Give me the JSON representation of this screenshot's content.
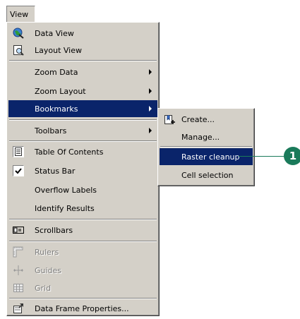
{
  "menubar": {
    "view_label": "View"
  },
  "view_menu": {
    "items": [
      {
        "label": "Data View",
        "icon": "globe-icon"
      },
      {
        "label": "Layout View",
        "icon": "page-magnifier-icon"
      },
      {
        "label": "Zoom Data"
      },
      {
        "label": "Zoom Layout"
      },
      {
        "label": "Bookmarks"
      },
      {
        "label": "Toolbars"
      },
      {
        "label": "Table Of Contents",
        "icon": "table-of-contents-icon"
      },
      {
        "label": "Status Bar",
        "icon": "checkmark-icon"
      },
      {
        "label": "Overflow Labels"
      },
      {
        "label": "Identify Results"
      },
      {
        "label": "Scrollbars",
        "icon": "scrollbar-icon"
      },
      {
        "label": "Rulers",
        "icon": "ruler-icon"
      },
      {
        "label": "Guides",
        "icon": "guides-icon"
      },
      {
        "label": "Grid",
        "icon": "grid-icon"
      },
      {
        "label": "Data Frame Properties...",
        "icon": "properties-icon"
      }
    ]
  },
  "bookmarks_submenu": {
    "items": [
      {
        "label": "Create...",
        "icon": "create-bookmark-icon"
      },
      {
        "label": "Manage..."
      },
      {
        "label": "Raster cleanup"
      },
      {
        "label": "Cell selection"
      }
    ]
  },
  "callout": {
    "number": "1",
    "color": "#1a7a5a"
  },
  "colors": {
    "menu_bg": "#d4d0c8",
    "highlight": "#0a246a",
    "disabled_text": "#808080"
  }
}
